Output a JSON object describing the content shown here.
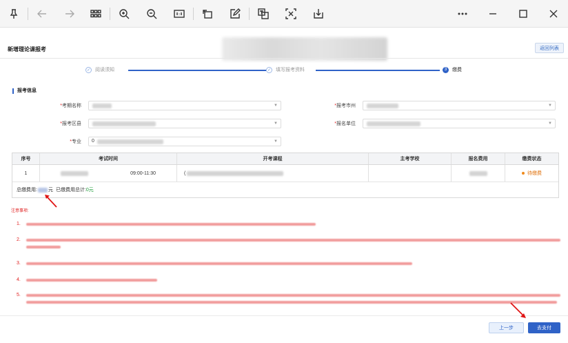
{
  "page": {
    "title": "新增理论课报考",
    "back_label": "返回列表"
  },
  "steps": [
    {
      "label": "阅读须知",
      "state": "done",
      "marker": "✓"
    },
    {
      "label": "填写报考资料",
      "state": "done",
      "marker": "✓"
    },
    {
      "label": "缴费",
      "state": "active",
      "marker": "3"
    }
  ],
  "form": {
    "section_title": "报考信息",
    "fields": [
      {
        "label": "考期名称",
        "required": "*",
        "value": ""
      },
      {
        "label": "报考市州",
        "required": "*",
        "value": ""
      },
      {
        "label": "报考区县",
        "required": "*",
        "value": ""
      },
      {
        "label": "报名单位",
        "required": "*",
        "value": ""
      },
      {
        "label": "专业",
        "required": "*",
        "value": "0"
      }
    ]
  },
  "table": {
    "headers": [
      "序号",
      "考试时间",
      "开考课程",
      "主考学校",
      "报名费用",
      "缴费状态"
    ],
    "rows": [
      {
        "index": "1",
        "time": "09:00-11:30",
        "course": "(",
        "school": "",
        "fee": "",
        "status": "待缴费"
      }
    ],
    "footer": {
      "total_label": "总缴费用:",
      "total_unit": "元",
      "paid_label": "已缴费用总计:",
      "paid_value": "0元"
    }
  },
  "notes": {
    "title": "注意事项:",
    "numbers": [
      "1.",
      "2.",
      "3.",
      "4.",
      "5."
    ]
  },
  "actions": {
    "prev_label": "上一步",
    "pay_label": "去支付"
  },
  "colors": {
    "primary": "#2f62c7",
    "notice": "#e02020",
    "pending": "#f08a1c",
    "paid": "#1f9d3a"
  },
  "toolbar_icons": [
    "pin-icon",
    "back-arrow-icon",
    "forward-arrow-icon",
    "grid-icon",
    "zoom-in-icon",
    "zoom-out-icon",
    "actual-size-icon",
    "rotate-icon",
    "edit-icon",
    "translate-icon",
    "text-recognize-icon",
    "download-icon",
    "more-icon",
    "minimize-icon",
    "maximize-icon",
    "close-icon"
  ]
}
